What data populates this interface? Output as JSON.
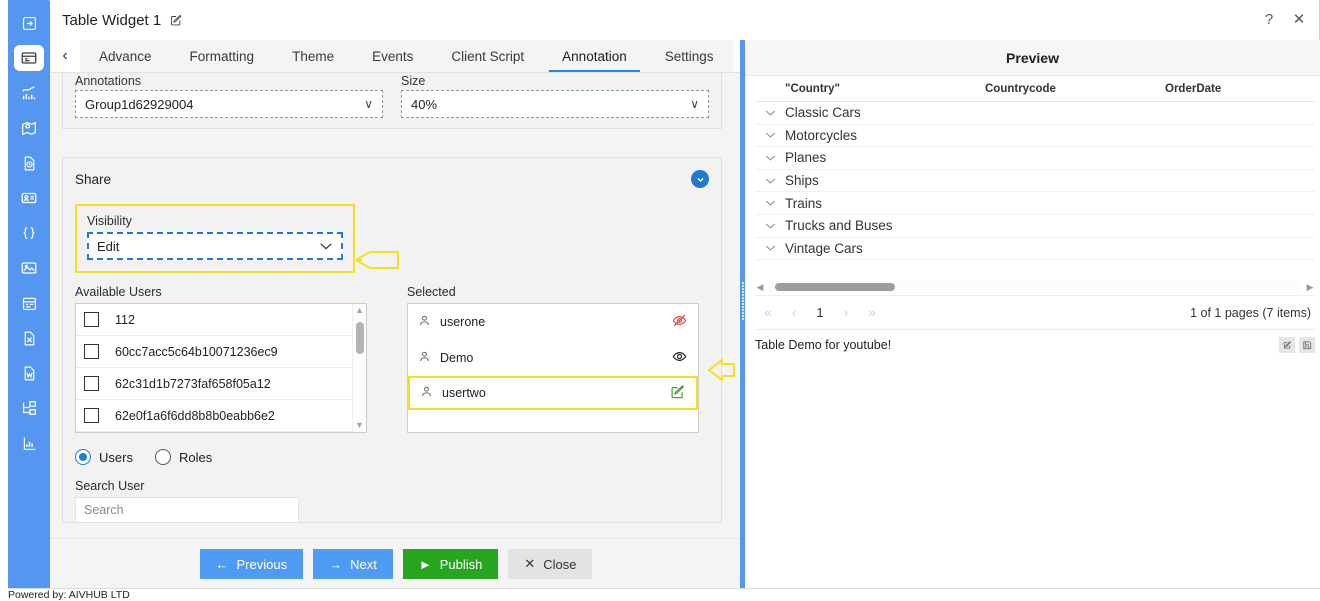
{
  "window": {
    "title": "Table Widget 1",
    "edit_icon": "pencil-square-icon",
    "help_label": "?",
    "close_label": "✕"
  },
  "rail": {
    "icons": [
      {
        "name": "arrow-into-box-icon",
        "active": false
      },
      {
        "name": "widget-card-icon",
        "active": true
      },
      {
        "name": "chart-line-icon",
        "active": false
      },
      {
        "name": "map-pin-icon",
        "active": false
      },
      {
        "name": "document-clock-icon",
        "active": false
      },
      {
        "name": "id-card-icon",
        "active": false
      },
      {
        "name": "code-braces-icon",
        "active": false
      },
      {
        "name": "image-icon",
        "active": false
      },
      {
        "name": "calendar-icon",
        "active": false
      },
      {
        "name": "excel-file-icon",
        "active": false
      },
      {
        "name": "word-file-icon",
        "active": false
      },
      {
        "name": "hierarchy-icon",
        "active": false
      },
      {
        "name": "bar-chart-icon",
        "active": false
      }
    ]
  },
  "tabs": {
    "prev_label": "‹",
    "next_label": "›",
    "items": [
      {
        "label": "Advance",
        "active": false
      },
      {
        "label": "Formatting",
        "active": false
      },
      {
        "label": "Theme",
        "active": false
      },
      {
        "label": "Events",
        "active": false
      },
      {
        "label": "Client Script",
        "active": false
      },
      {
        "label": "Annotation",
        "active": true
      },
      {
        "label": "Settings",
        "active": false
      }
    ]
  },
  "annotation_card": {
    "annotations_label": "Annotations",
    "annotations_value": "Group1d62929004",
    "size_label": "Size",
    "size_value": "40%",
    "chevron": "∨"
  },
  "share": {
    "title": "Share",
    "collapse_icon": "chevron-down-icon",
    "visibility_label": "Visibility",
    "visibility_value": "Edit",
    "available_label": "Available Users",
    "available_users": [
      "112",
      "60cc7acc5c64b10071236ec9",
      "62c31d1b7273faf658f05a12",
      "62e0f1a6f6dd8b8b0eabb6e2"
    ],
    "selected_label": "Selected",
    "selected_users": [
      {
        "name": "userone",
        "action_icon": "eye-slash-icon",
        "action_color": "#d64545",
        "highlighted": false
      },
      {
        "name": "Demo",
        "action_icon": "eye-icon",
        "action_color": "#222222",
        "highlighted": false
      },
      {
        "name": "usertwo",
        "action_icon": "pencil-square-icon",
        "action_color": "#3f9c35",
        "highlighted": true
      }
    ],
    "radio_users": "Users",
    "radio_roles": "Roles",
    "radio_selected": "Users",
    "search_label": "Search User",
    "search_placeholder": "Search",
    "search_value": ""
  },
  "footer": {
    "previous": "Previous",
    "next": "Next",
    "publish": "Publish",
    "close": "Close"
  },
  "preview": {
    "title": "Preview",
    "columns": [
      "\"Country\"",
      "Countrycode",
      "OrderDate"
    ],
    "rows": [
      "Classic Cars",
      "Motorcycles",
      "Planes",
      "Ships",
      "Trains",
      "Trucks and Buses",
      "Vintage Cars"
    ],
    "pager": {
      "first": "«",
      "prev": "‹",
      "page": "1",
      "next": "›",
      "last": "»",
      "info": "1 of 1 pages (7 items)"
    },
    "caption": "Table Demo for youtube!",
    "caption_icons": [
      "edit-icon",
      "save-icon"
    ]
  },
  "status": {
    "powered_by": "Powered by: AIVHUB LTD"
  },
  "colors": {
    "accent": "#5596f0",
    "tab_active": "#2b88d8",
    "publish": "#27a520",
    "highlight": "#f5e01f"
  }
}
